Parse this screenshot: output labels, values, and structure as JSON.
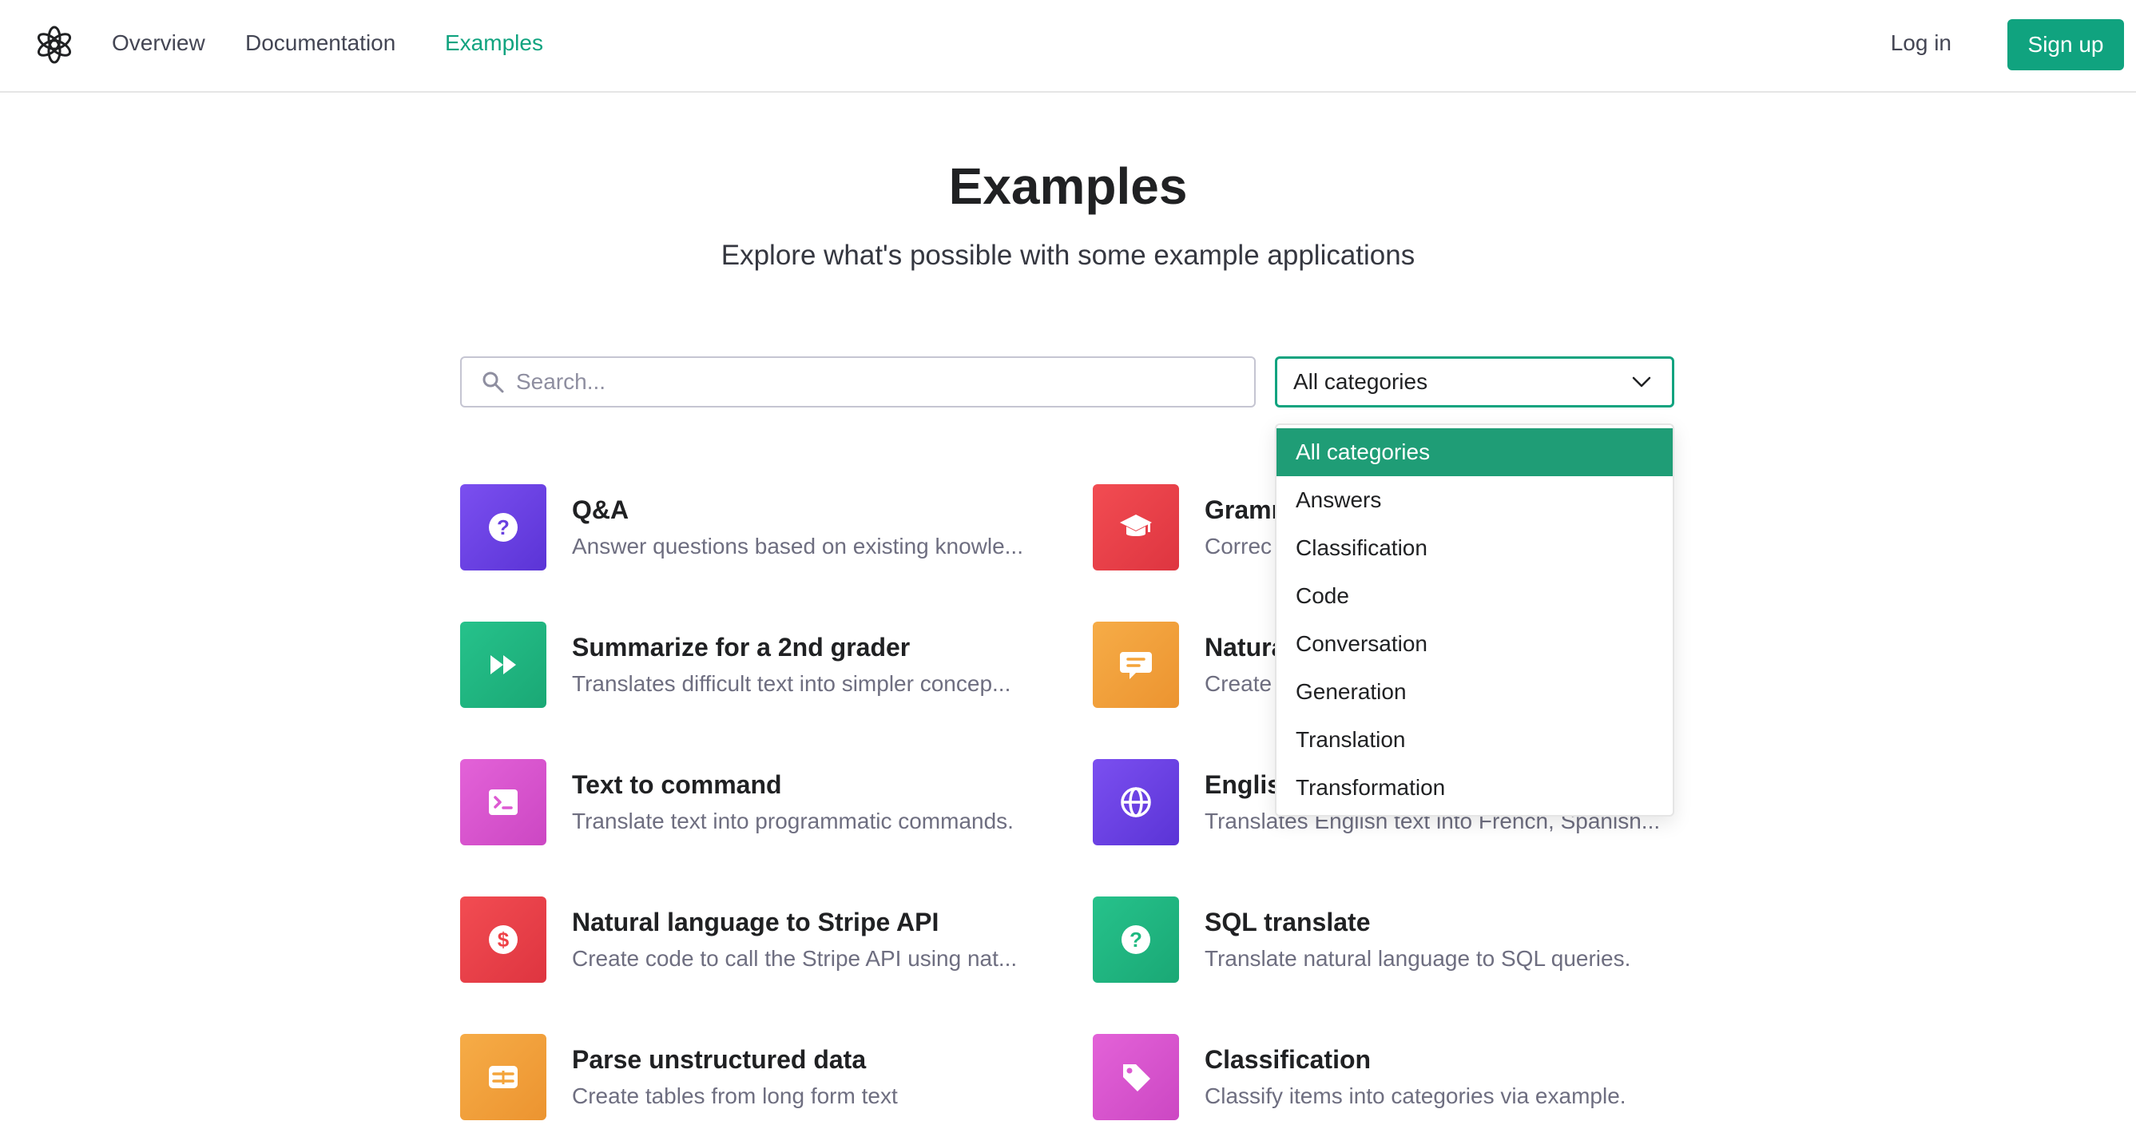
{
  "nav": {
    "logo": "openai-logo",
    "links": [
      "Overview",
      "Documentation",
      "Examples"
    ],
    "active_link": "Examples",
    "login": "Log in",
    "signup": "Sign up"
  },
  "header": {
    "title": "Examples",
    "subtitle": "Explore what's possible with some example applications"
  },
  "search": {
    "placeholder": "Search...",
    "value": ""
  },
  "category_select": {
    "value": "All categories",
    "options": [
      "All categories",
      "Answers",
      "Classification",
      "Code",
      "Conversation",
      "Generation",
      "Translation",
      "Transformation"
    ],
    "selected": "All categories"
  },
  "examples": [
    {
      "title": "Q&A",
      "desc": "Answer questions based on existing knowle...",
      "icon": "question-icon",
      "color": "#6840e0"
    },
    {
      "title": "Gramm",
      "desc": "Correc",
      "icon": "graduation-cap-icon",
      "color": "#ef4146"
    },
    {
      "title": "Summarize for a 2nd grader",
      "desc": "Translates difficult text into simpler concep...",
      "icon": "fast-forward-icon",
      "color": "#1eb980"
    },
    {
      "title": "Natura",
      "desc": "Create",
      "icon": "chat-message-icon",
      "color": "#f4a43a"
    },
    {
      "title": "Text to command",
      "desc": "Translate text into programmatic commands.",
      "icon": "terminal-icon",
      "color": "#dd5ad2"
    },
    {
      "title": "Englis",
      "desc": "Translates English text into French, Spanish...",
      "icon": "globe-icon",
      "color": "#6840e0"
    },
    {
      "title": "Natural language to Stripe API",
      "desc": "Create code to call the Stripe API using nat...",
      "icon": "dollar-icon",
      "color": "#ef4146"
    },
    {
      "title": "SQL translate",
      "desc": "Translate natural language to SQL queries.",
      "icon": "question-icon",
      "color": "#1eb980"
    },
    {
      "title": "Parse unstructured data",
      "desc": "Create tables from long form text",
      "icon": "table-icon",
      "color": "#f4a43a"
    },
    {
      "title": "Classification",
      "desc": "Classify items into categories via example.",
      "icon": "tag-icon",
      "color": "#dd5ad2"
    }
  ],
  "colors": {
    "accent": "#10a37f",
    "text": "#202123",
    "muted": "#6e6e80",
    "border": "#e5e5e5"
  }
}
